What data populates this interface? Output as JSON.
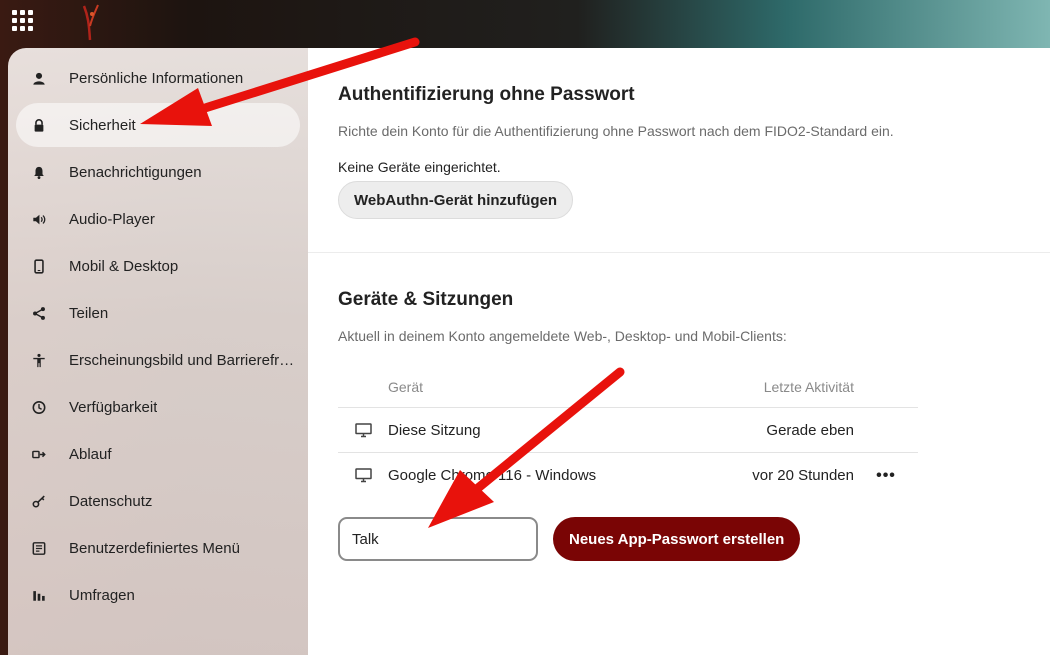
{
  "sidebar": {
    "items": [
      {
        "label": "Persönliche Informationen",
        "icon": "user-icon"
      },
      {
        "label": "Sicherheit",
        "icon": "lock-icon"
      },
      {
        "label": "Benachrichtigungen",
        "icon": "bell-icon"
      },
      {
        "label": "Audio-Player",
        "icon": "speaker-icon"
      },
      {
        "label": "Mobil & Desktop",
        "icon": "phone-icon"
      },
      {
        "label": "Teilen",
        "icon": "share-icon"
      },
      {
        "label": "Erscheinungsbild und Barrierefre...",
        "icon": "accessibility-icon"
      },
      {
        "label": "Verfügbarkeit",
        "icon": "clock-icon"
      },
      {
        "label": "Ablauf",
        "icon": "flow-icon"
      },
      {
        "label": "Datenschutz",
        "icon": "key-icon"
      },
      {
        "label": "Benutzerdefiniertes Menü",
        "icon": "menu-icon"
      },
      {
        "label": "Umfragen",
        "icon": "poll-icon"
      }
    ]
  },
  "passwordless": {
    "title": "Authentifizierung ohne Passwort",
    "hint": "Richte dein Konto für die Authentifizierung ohne Passwort nach dem FIDO2-Standard ein.",
    "status": "Keine Geräte eingerichtet.",
    "button": "WebAuthn-Gerät hinzufügen"
  },
  "sessions": {
    "title": "Geräte & Sitzungen",
    "hint": "Aktuell in deinem Konto angemeldete Web-, Desktop- und Mobil-Clients:",
    "col_device": "Gerät",
    "col_activity": "Letzte Aktivität",
    "rows": [
      {
        "device": "Diese Sitzung",
        "activity": "Gerade eben",
        "icon": "monitor-icon"
      },
      {
        "device": "Google Chrome 116 - Windows",
        "activity": "vor 20 Stunden",
        "icon": "monitor-icon",
        "menu": "•••"
      }
    ],
    "app_name_value": "Talk",
    "create_button": "Neues App-Passwort erstellen"
  },
  "colors": {
    "primary": "#7a0505",
    "annotation_arrow": "#e8120c"
  }
}
